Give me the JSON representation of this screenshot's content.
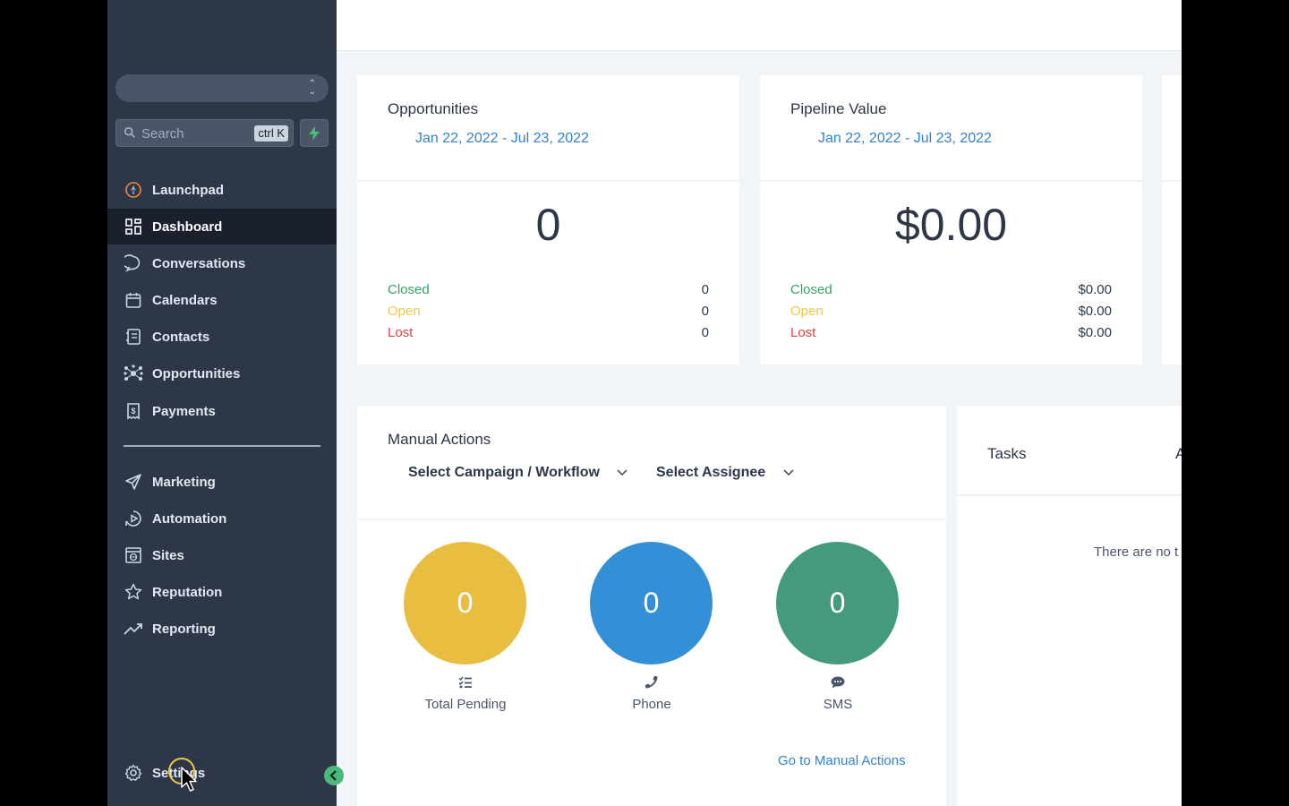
{
  "sidebar": {
    "search_placeholder": "Search",
    "search_shortcut": "ctrl K",
    "items": [
      {
        "label": "Launchpad",
        "icon": "rocket-icon"
      },
      {
        "label": "Dashboard",
        "icon": "grid-icon",
        "active": true
      },
      {
        "label": "Conversations",
        "icon": "chat-icon"
      },
      {
        "label": "Calendars",
        "icon": "calendar-icon"
      },
      {
        "label": "Contacts",
        "icon": "contacts-book-icon"
      },
      {
        "label": "Opportunities",
        "icon": "network-icon"
      },
      {
        "label": "Payments",
        "icon": "receipt-icon"
      }
    ],
    "items2": [
      {
        "label": "Marketing",
        "icon": "send-icon"
      },
      {
        "label": "Automation",
        "icon": "play-circle-icon"
      },
      {
        "label": "Sites",
        "icon": "browser-globe-icon"
      },
      {
        "label": "Reputation",
        "icon": "star-icon"
      },
      {
        "label": "Reporting",
        "icon": "trending-up-icon"
      }
    ],
    "settings_label": "Settings"
  },
  "opportunities": {
    "title": "Opportunities",
    "date_range": "Jan 22, 2022 - Jul 23, 2022",
    "total": "0",
    "closed_label": "Closed",
    "closed_value": "0",
    "open_label": "Open",
    "open_value": "0",
    "lost_label": "Lost",
    "lost_value": "0"
  },
  "pipeline": {
    "title": "Pipeline Value",
    "date_range": "Jan 22, 2022 - Jul 23, 2022",
    "total": "$0.00",
    "closed_label": "Closed",
    "closed_value": "$0.00",
    "open_label": "Open",
    "open_value": "$0.00",
    "lost_label": "Lost",
    "lost_value": "$0.00"
  },
  "manual_actions": {
    "title": "Manual Actions",
    "campaign_select": "Select Campaign / Workflow",
    "assignee_select": "Select Assignee",
    "total_pending_value": "0",
    "total_pending_label": "Total Pending",
    "phone_value": "0",
    "phone_label": "Phone",
    "sms_value": "0",
    "sms_label": "SMS",
    "link": "Go to Manual Actions"
  },
  "tasks": {
    "title": "Tasks",
    "header_right_partial": "A",
    "empty_text": "There are no t"
  },
  "colors": {
    "sidebar_bg": "#2d3748",
    "active_bg": "#1a202c",
    "accent_blue": "#3182ce",
    "closed_green": "#38a169",
    "open_yellow": "#ecc94b",
    "lost_red": "#e53e3e",
    "pending_yellow": "#e9bd40",
    "phone_blue": "#3490d6",
    "sms_green": "#439a7e"
  }
}
